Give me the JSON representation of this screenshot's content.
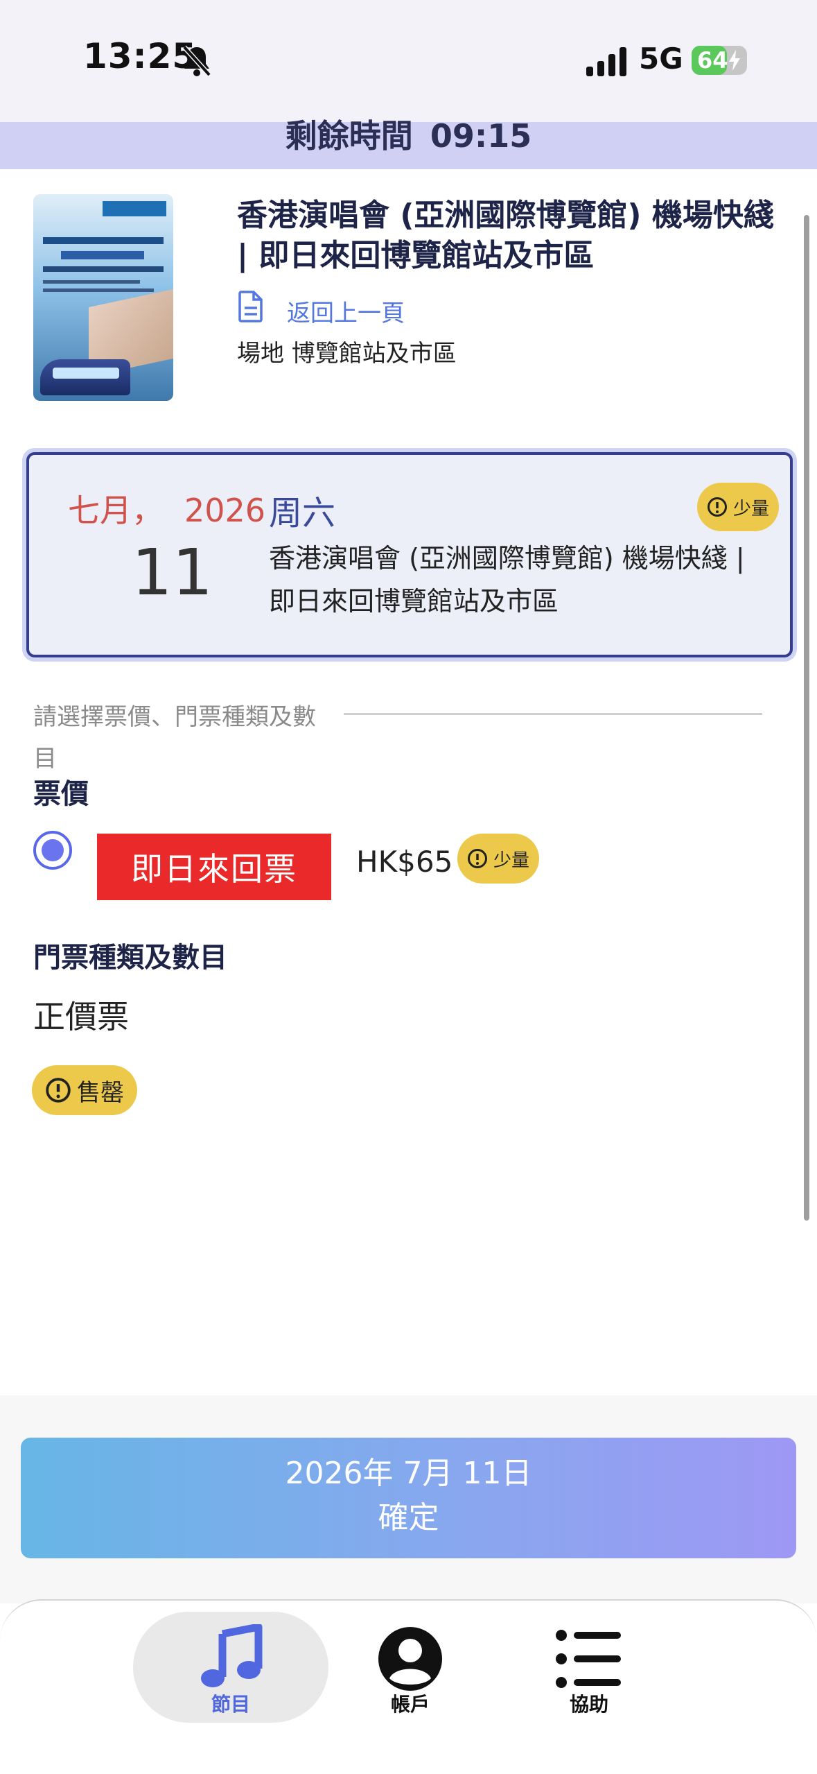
{
  "status_bar": {
    "time": "13:25",
    "network": "5G",
    "battery": "64",
    "battery_level": 0.64,
    "icons": [
      "bell-off-icon",
      "signal-icon",
      "battery-icon",
      "charging-bolt-icon"
    ]
  },
  "timer": {
    "label": "剩餘時間",
    "value": "09:15"
  },
  "event": {
    "title": "香港演唱會 (亞洲國際博覽館) 機場快綫 | 即日來回博覽館站及市區",
    "back_link": "返回上一頁",
    "venue": "場地 博覽館站及市區"
  },
  "date_card": {
    "month": "七月，",
    "year": "2026",
    "weekday": "周六",
    "day": "11",
    "title": "香港演唱會 (亞洲國際博覽館) 機場快綫 | 即日來回博覽館站及市區",
    "badge": "少量"
  },
  "selection": {
    "instruction": "請選擇票價、門票種類及數目",
    "price_heading": "票價",
    "ticket_button": "即日來回票",
    "price": "HK$65",
    "price_badge": "少量",
    "types_heading": "門票種類及數目",
    "ticket_type": "正價票",
    "soldout_badge": "售罄"
  },
  "footer": {
    "date": "2026年 7月 11日",
    "confirm": "確定"
  },
  "tabs": [
    {
      "label": "節目",
      "icon": "music-note-icon",
      "active": true
    },
    {
      "label": "帳戶",
      "icon": "account-icon",
      "active": false
    },
    {
      "label": "協助",
      "icon": "list-icon",
      "active": false
    }
  ],
  "colors": {
    "accent": "#5067e0",
    "timer_bg": "#cfd0f3",
    "ticket_button": "#ea2a2a",
    "badge": "#ecc94b",
    "date_red": "#d0524a",
    "card_border": "#353d8c"
  }
}
